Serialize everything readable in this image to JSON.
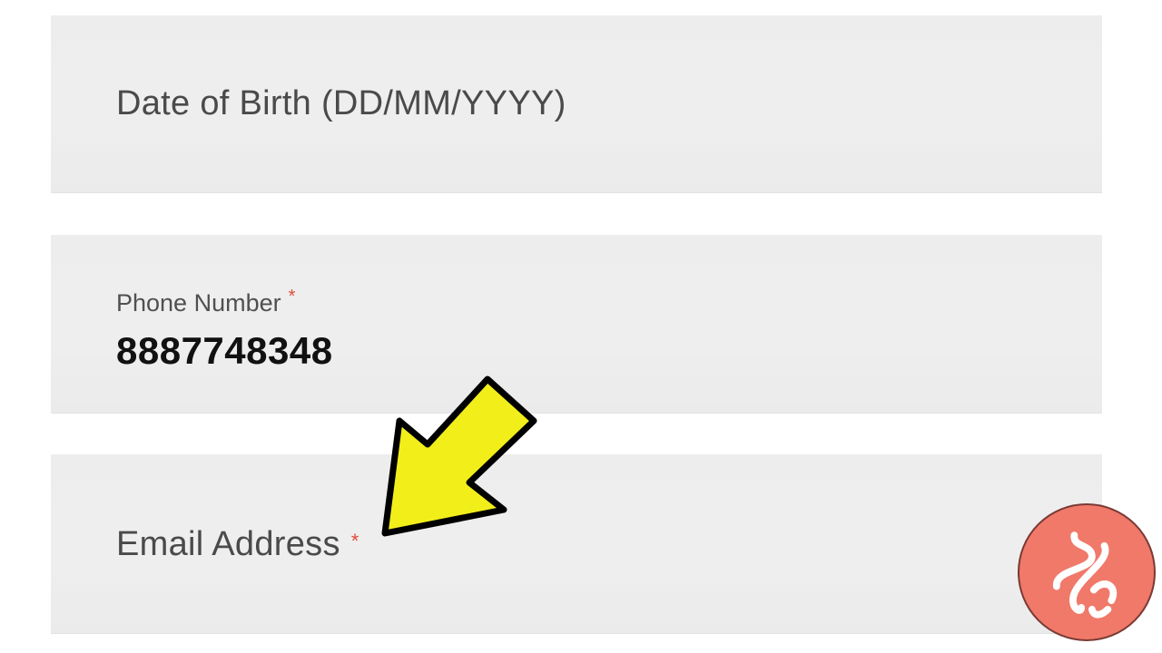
{
  "form": {
    "date_of_birth": {
      "placeholder": "Date of Birth (DD/MM/YYYY)"
    },
    "phone": {
      "label": "Phone Number",
      "required_marker": "*",
      "value": "8887748348"
    },
    "email": {
      "placeholder": "Email Address",
      "required_marker": "*"
    }
  },
  "annotation": {
    "arrow_color": "#f2ee1a",
    "arrow_outline": "#000000",
    "points_to": "email-field"
  },
  "branding": {
    "badge_icon": "logo-icon",
    "badge_color": "#f0796a"
  },
  "colors": {
    "field_background": "#eeeeee",
    "required_marker": "#e04a3a"
  }
}
